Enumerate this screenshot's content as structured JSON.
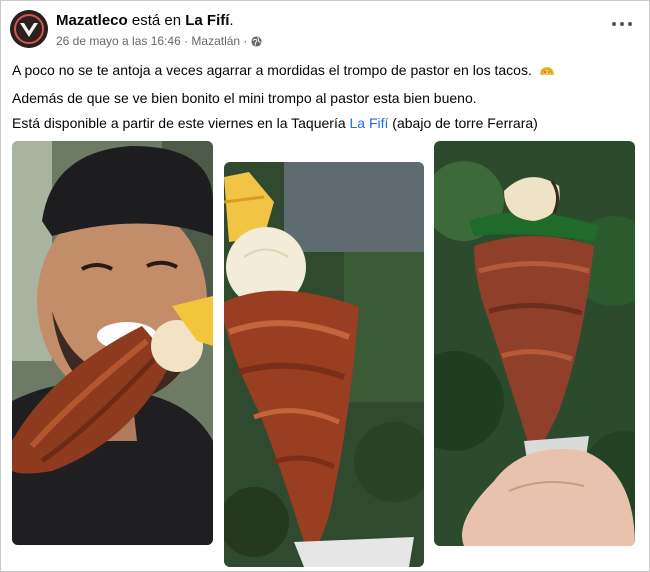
{
  "post": {
    "author": "Mazatleco",
    "connector": " está en ",
    "place": "La Fifí",
    "place_suffix": ".",
    "date": "26 de mayo a las 16:46 · Mazatlán ·",
    "line1": "A poco no se te antoja a veces agarrar a mordidas el trompo de pastor en los tacos.",
    "line2": "Además de que se ve bien bonito el mini trompo al pastor esta bien bueno.",
    "line3_before": "Está disponible a partir de este viernes en la Taquería ",
    "line3_link": "La Fifí",
    "line3_after": " (abajo de torre Ferrara)"
  },
  "icons": {
    "more": "more-options-icon",
    "privacy": "globe-icon",
    "emoji": "taco-emoji"
  },
  "colors": {
    "link": "#216fdb",
    "muted": "#65676b"
  }
}
